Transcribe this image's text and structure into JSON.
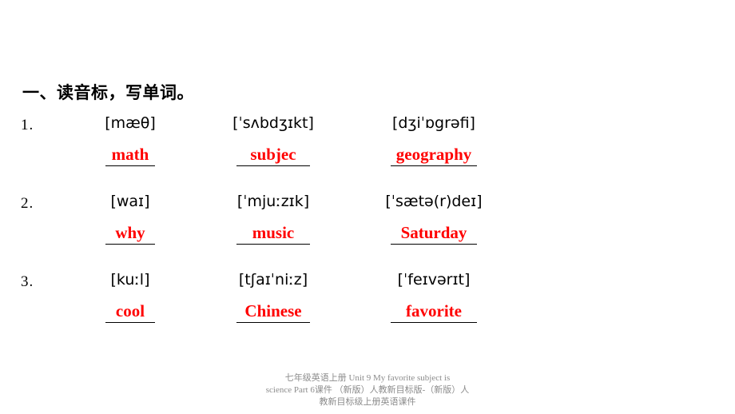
{
  "page": {
    "background": "#ffffff",
    "answer_color": "#ff0000",
    "text_color": "#000000",
    "footer_color": "#8c8c8c"
  },
  "title": "一、读音标，写单词。",
  "exercise": {
    "rows": [
      {
        "number": "1.",
        "items": [
          {
            "phonetic": "[mæθ]",
            "answer": "math"
          },
          {
            "phonetic": "[ˈsʌbdʒɪkt]",
            "answer": "subjec"
          },
          {
            "phonetic": "[dʒiˈɒgrəfi]",
            "answer": "geography"
          }
        ]
      },
      {
        "number": "2.",
        "items": [
          {
            "phonetic": "[waɪ]",
            "answer": "why"
          },
          {
            "phonetic": "[ˈmjuːzɪk]",
            "answer": "music"
          },
          {
            "phonetic": "[ˈsætə(r)deɪ]",
            "answer": "Saturday"
          }
        ]
      },
      {
        "number": "3.",
        "items": [
          {
            "phonetic": "[kuːl]",
            "answer": "cool"
          },
          {
            "phonetic": "[tʃaɪˈniːz]",
            "answer": "Chinese"
          },
          {
            "phonetic": "[ˈfeɪvərɪt]",
            "answer": "favorite"
          }
        ]
      }
    ]
  },
  "footer": {
    "line1": "七年级英语上册 Unit 9 My favorite subject is",
    "line2": "science Part 6课件 （新版）人教新目标版-（新版）人",
    "line3": "教新目标级上册英语课件"
  }
}
